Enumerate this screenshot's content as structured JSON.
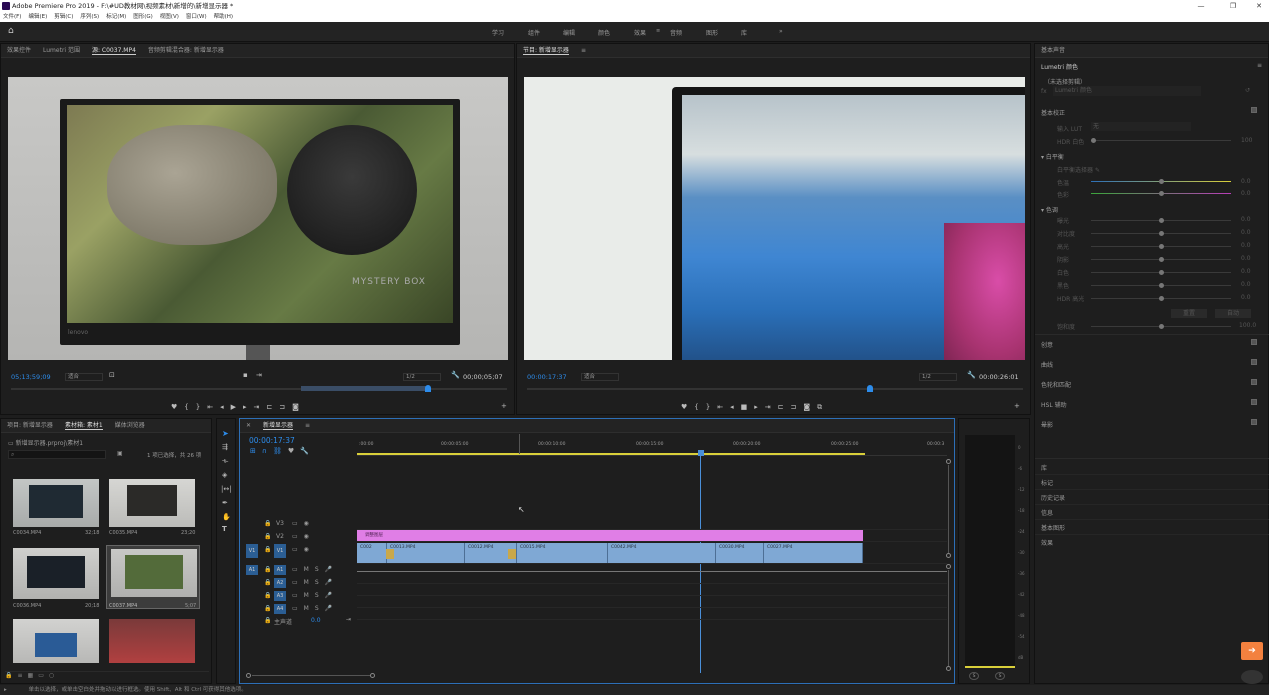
{
  "app": {
    "title": "Adobe Premiere Pro 2019 - F:\\#UD教材网\\视频素材\\新增的\\新增显示器 *"
  },
  "menu": [
    "文件(F)",
    "编辑(E)",
    "剪辑(C)",
    "序列(S)",
    "标记(M)",
    "图形(G)",
    "视图(V)",
    "窗口(W)",
    "帮助(H)"
  ],
  "workspaces": [
    "学习",
    "组件",
    "编辑",
    "颜色",
    "效果",
    "音频",
    "图形",
    "库"
  ],
  "workspace_more": "»",
  "source": {
    "tabs": [
      "效果控件",
      "Lumetri 范围",
      "源: C0037.MP4",
      "音频剪辑混合器: 新增显示器"
    ],
    "timecode": "05;13;59;09",
    "fit": "适合",
    "ratio": "1/2",
    "duration": "00;00;05;07",
    "watermark": "MYSTERY BOX",
    "brand": "lenovo"
  },
  "program": {
    "title": "节目: 新增显示器",
    "timecode": "00:00:17:37",
    "fit": "适合",
    "ratio": "1/2",
    "duration": "00:00:26:01"
  },
  "project": {
    "tabs": [
      "项目: 新增显示器",
      "素材箱: 素材1",
      "媒体浏览器"
    ],
    "path": "新增显示器.prproj\\素材1",
    "selection": "1 项已选择，共 26 项",
    "items": [
      {
        "name": "C0034.MP4",
        "dur": "32;18"
      },
      {
        "name": "C0035.MP4",
        "dur": "23;20"
      },
      {
        "name": "C0036.MP4",
        "dur": "20;18"
      },
      {
        "name": "C0037.MP4",
        "dur": "5;07"
      }
    ]
  },
  "timeline": {
    "title": "新增显示器",
    "timecode": "00:00:17:37",
    "ruler": [
      ":00:00",
      "00:00:05:00",
      "00:00:10:00",
      "00:00:15:00",
      "00:00:20:00",
      "00:00:25:00",
      "00:00:3"
    ],
    "video_tracks": [
      "V3",
      "V2",
      "V1"
    ],
    "audio_tracks": [
      "A1",
      "A2",
      "A3",
      "A4"
    ],
    "master": "主声道",
    "master_val": "0.0",
    "adjustment": "调整图层",
    "clips": [
      "C002",
      "C0013.MP4",
      "C0012.MP4",
      "C0015.MP4",
      "C0042.MP4",
      "C0030.MP4",
      "C0027.MP4"
    ],
    "meter_scale": [
      "0",
      "-6",
      "-12",
      "-18",
      "-24",
      "-30",
      "-36",
      "-42",
      "-48",
      "-54",
      "dB"
    ],
    "meter_solo": [
      "S",
      "S"
    ]
  },
  "lumetri": {
    "panel_title": "基本声音",
    "title": "Lumetri 颜色",
    "noclip": "（未选择剪辑）",
    "fx": "fx",
    "clip_select": "Lumetri 颜色",
    "basic": "基本校正",
    "input_lut": "输入 LUT",
    "lut_value": "无",
    "hdr": "HDR 白色",
    "hdr_val": "100",
    "wb": "白平衡",
    "wb_picker": "白平衡选择器",
    "wb_controls": [
      {
        "label": "色温",
        "val": "0.0"
      },
      {
        "label": "色彩",
        "val": "0.0"
      }
    ],
    "tone": "色调",
    "tone_controls": [
      {
        "label": "曝光",
        "val": "0.0"
      },
      {
        "label": "对比度",
        "val": "0.0"
      },
      {
        "label": "高光",
        "val": "0.0"
      },
      {
        "label": "阴影",
        "val": "0.0"
      },
      {
        "label": "白色",
        "val": "0.0"
      },
      {
        "label": "黑色",
        "val": "0.0"
      },
      {
        "label": "HDR 高光",
        "val": "0.0"
      }
    ],
    "saturation": "饱和度",
    "saturation_val": "100.0",
    "reset": "重置",
    "auto": "自动",
    "sections": [
      "创意",
      "曲线",
      "色轮和匹配",
      "HSL 辅助",
      "晕影"
    ],
    "others": [
      "库",
      "标记",
      "历史记录",
      "信息",
      "基本图形",
      "效果"
    ]
  },
  "status": {
    "text": "单击以选择，或单击空白处并拖动以进行框选。使用 Shift、Alt 和 Ctrl 可获得其他选项。"
  },
  "colors": {
    "accent": "#2d8ceb",
    "adjust_clip": "#e07ee6",
    "video_clip": "#7fa8d4",
    "work_area": "#d9cf3a",
    "playhead": "#4a8fd9"
  }
}
